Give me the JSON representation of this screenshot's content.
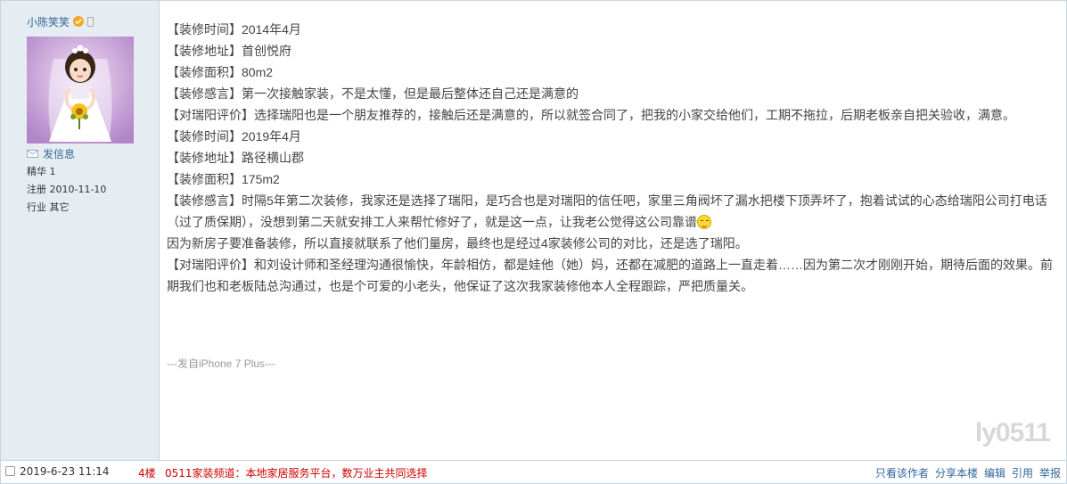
{
  "user": {
    "name": "小陈笑笑",
    "message_link": "发信息",
    "info": [
      "精华 1",
      "注册 2010-11-10",
      "行业 其它"
    ]
  },
  "post": {
    "lines": [
      "【装修时间】2014年4月",
      "【装修地址】首创悦府",
      "【装修面积】80m2",
      "【装修感言】第一次接触家装，不是太懂，但是最后整体还自己还是满意的",
      "【对瑞阳评价】选择瑞阳也是一个朋友推荐的，接触后还是满意的，所以就签合同了，把我的小家交给他们，工期不拖拉，后期老板亲自把关验收，满意。",
      "【装修时间】2019年4月",
      "【装修地址】路径横山郡",
      "【装修面积】175m2",
      "【装修感言】时隔5年第二次装修，我家还是选择了瑞阳，是巧合也是对瑞阳的信任吧，家里三角阀坏了漏水把楼下顶弄坏了，抱着试试的心态给瑞阳公司打电话（过了质保期），没想到第二天就安排工人来帮忙修好了，就是这一点，让我老公觉得这公司靠谱",
      "因为新房子要准备装修，所以直接就联系了他们量房，最终也是经过4家装修公司的对比，还是选了瑞阳。",
      "【对瑞阳评价】和刘设计师和圣经理沟通很愉快，年龄相仿，都是娃他（她）妈，还都在减肥的道路上一直走着……因为第二次才刚刚开始，期待后面的效果。前期我们也和老板陆总沟通过，也是个可爱的小老头，他保证了这次我家装修他本人全程跟踪，严把质量关。"
    ],
    "signature": "---发自iPhone 7 Plus---",
    "watermark": "ly0511"
  },
  "footer": {
    "date": "2019-6-23 11:14",
    "floor": "4楼",
    "ad": "0511家装频道：本地家居服务平台，数万业主共同选择",
    "actions": [
      "只看该作者",
      "分享本楼",
      "编辑",
      "引用",
      "举报"
    ]
  },
  "colors": {
    "link": "#336699",
    "sidebar_bg": "#e5edf2",
    "border": "#c2d5e3",
    "accent_red": "#cc0000"
  }
}
